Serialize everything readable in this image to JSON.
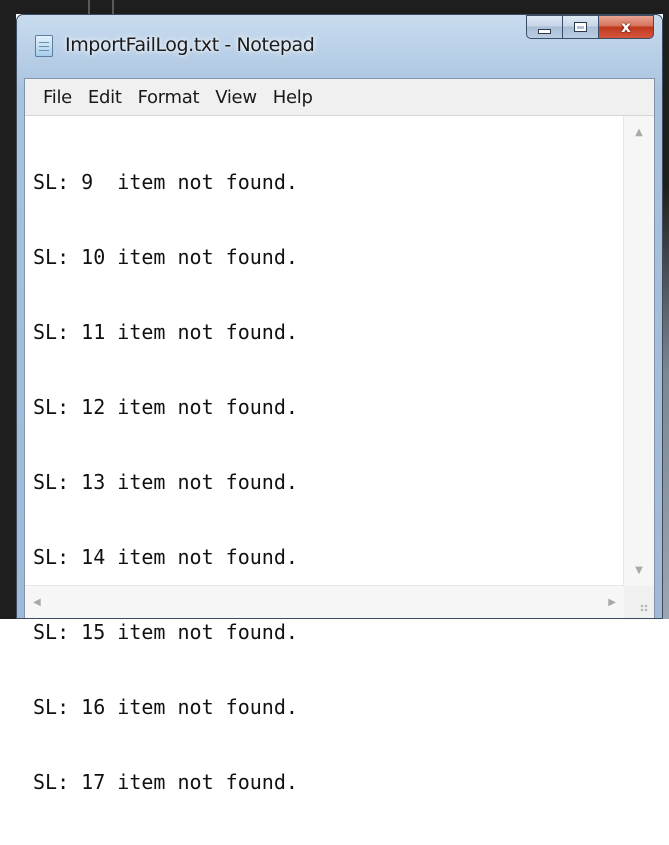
{
  "window": {
    "title": "ImportFailLog.txt - Notepad",
    "icon": "notepad-icon",
    "controls": {
      "minimize_icon": "minimize-icon",
      "maximize_icon": "maximize-icon",
      "close_glyph": "x"
    }
  },
  "menu": {
    "items": [
      "File",
      "Edit",
      "Format",
      "View",
      "Help"
    ]
  },
  "editor": {
    "lines": [
      "SL: 9  item not found.",
      "SL: 10 item not found.",
      "SL: 11 item not found.",
      "SL: 12 item not found.",
      "SL: 13 item not found.",
      "SL: 14 item not found.",
      "SL: 15 item not found.",
      "SL: 16 item not found.",
      "SL: 17 item not found."
    ]
  },
  "scrollbars": {
    "up_arrow": "▲",
    "down_arrow": "▼",
    "left_arrow": "◀",
    "right_arrow": "▶"
  },
  "colors": {
    "frame": "#b8cfe7",
    "close_button": "#c0391f",
    "menubar": "#f0f0f0"
  }
}
